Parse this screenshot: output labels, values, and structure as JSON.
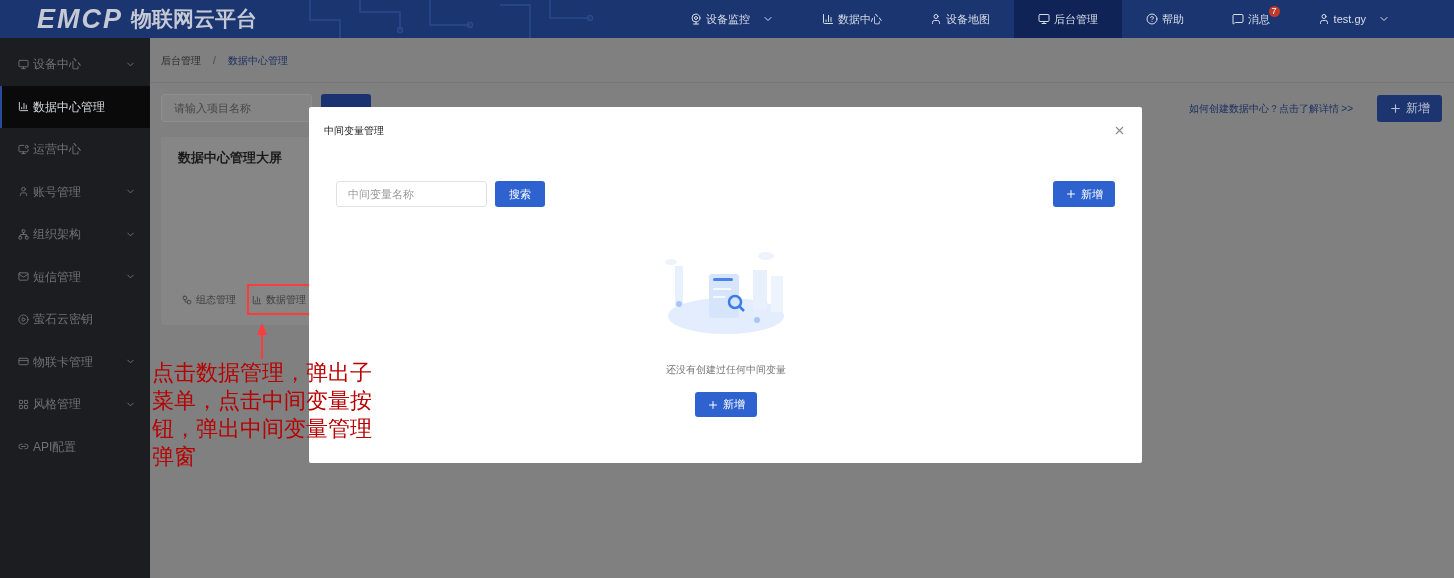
{
  "header": {
    "logo": {
      "mark": "EMCP",
      "title": "物联网云平台"
    },
    "nav": [
      {
        "label": "设备监控",
        "dropdown": true,
        "selected": false
      },
      {
        "label": "数据中心",
        "dropdown": false,
        "selected": false
      },
      {
        "label": "设备地图",
        "dropdown": false,
        "selected": false
      },
      {
        "label": "后台管理",
        "dropdown": false,
        "selected": true
      },
      {
        "label": "帮助",
        "dropdown": false,
        "selected": false
      },
      {
        "label": "消息",
        "dropdown": false,
        "selected": false,
        "badge": "7"
      },
      {
        "label": "test.gy",
        "dropdown": true,
        "selected": false
      }
    ]
  },
  "sidebar": {
    "items": [
      {
        "label": "设备中心",
        "expandable": true,
        "selected": false
      },
      {
        "label": "数据中心管理",
        "expandable": false,
        "selected": true
      },
      {
        "label": "运营中心",
        "expandable": false,
        "selected": false
      },
      {
        "label": "账号管理",
        "expandable": true,
        "selected": false
      },
      {
        "label": "组织架构",
        "expandable": true,
        "selected": false
      },
      {
        "label": "短信管理",
        "expandable": true,
        "selected": false
      },
      {
        "label": "萤石云密钥",
        "expandable": false,
        "selected": false
      },
      {
        "label": "物联卡管理",
        "expandable": true,
        "selected": false
      },
      {
        "label": "风格管理",
        "expandable": true,
        "selected": false
      },
      {
        "label": "API配置",
        "expandable": false,
        "selected": false
      }
    ]
  },
  "page": {
    "breadcrumb": [
      {
        "label": "后台管理",
        "current": false
      },
      {
        "label": "数据中心管理",
        "current": true
      }
    ],
    "breadcrumb_separator": "/",
    "search": {
      "placeholder": "请输入项目名称"
    },
    "help_link": "如何创建数据中心？点击了解详情 >>",
    "new_button": "新增",
    "card": {
      "title": "数据中心管理大屏",
      "actions": [
        {
          "label": "组态管理",
          "highlighted": false
        },
        {
          "label": "数据管理",
          "highlighted": true
        }
      ]
    }
  },
  "annotation": "点击数据管理，弹出子菜单，点击中间变量按钮，弹出中间变量管理弹窗",
  "modal": {
    "title": "中间变量管理",
    "search": {
      "placeholder": "中间变量名称"
    },
    "search_button": "搜索",
    "new_button": "新增",
    "empty_text": "还没有创建过任何中间变量",
    "empty_button": "新增"
  }
}
